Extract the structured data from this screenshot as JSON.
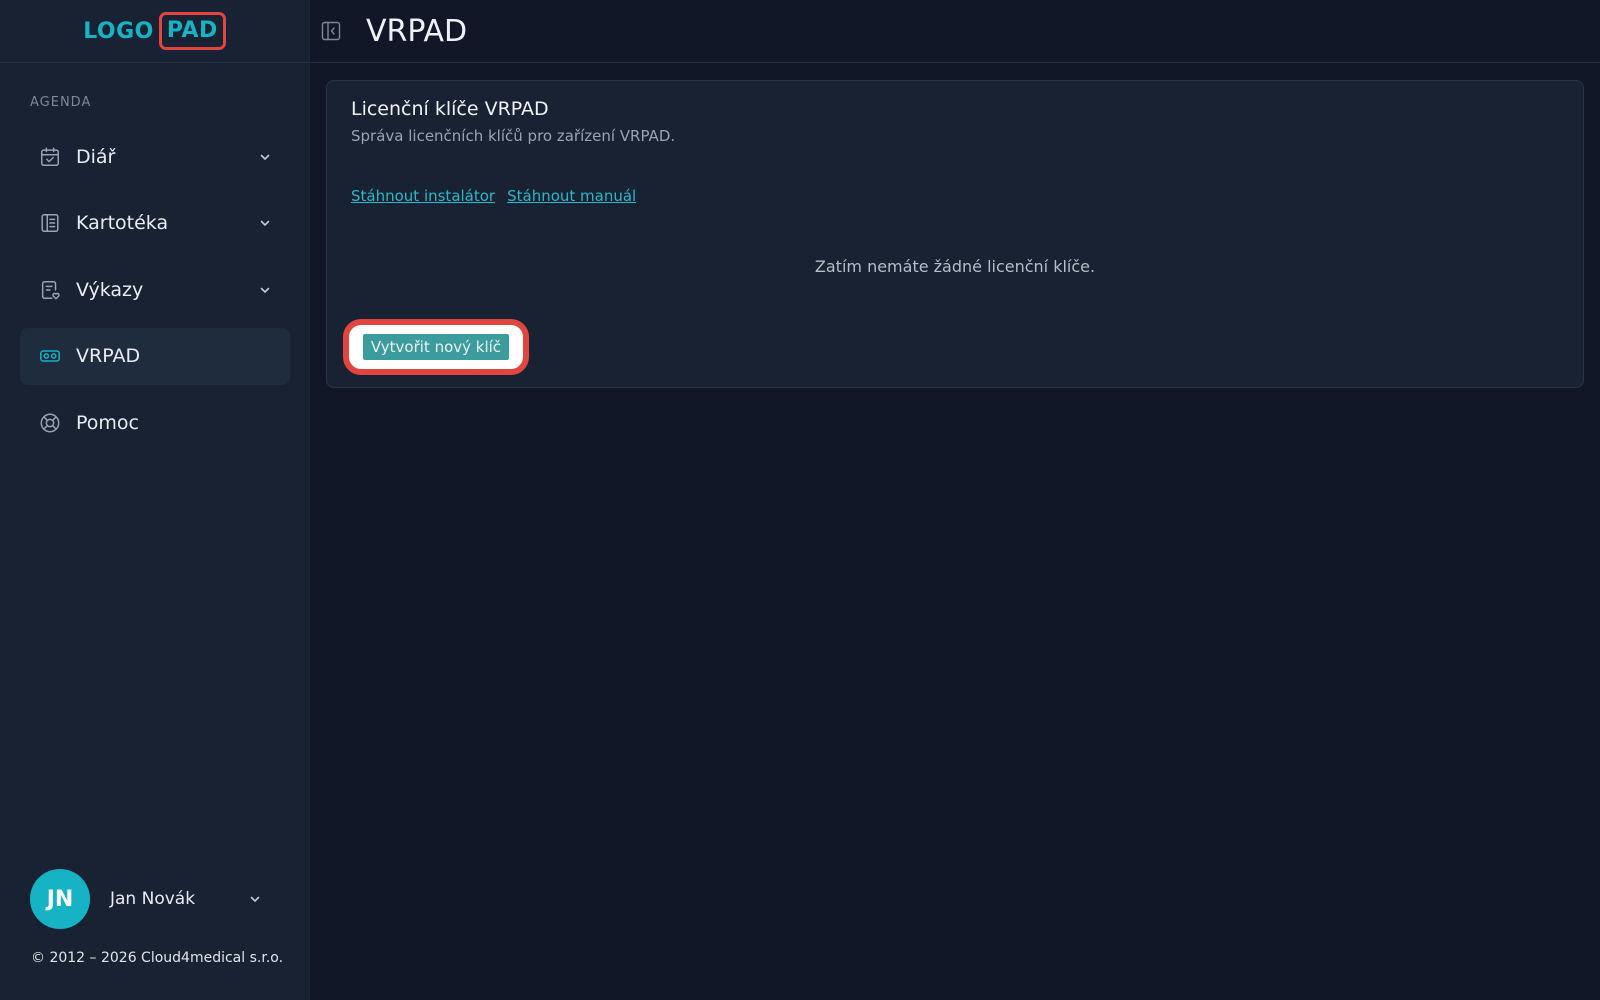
{
  "brand": {
    "logo_left": "LOGO",
    "logo_right": "PAD"
  },
  "sidebar": {
    "section_label": "AGENDA",
    "items": [
      {
        "label": "Diář",
        "icon": "calendar-check-icon",
        "has_chevron": true,
        "active": false
      },
      {
        "label": "Kartotéka",
        "icon": "card-file-icon",
        "has_chevron": true,
        "active": false
      },
      {
        "label": "Výkazy",
        "icon": "report-heart-icon",
        "has_chevron": true,
        "active": false
      },
      {
        "label": "VRPAD",
        "icon": "vr-headset-icon",
        "has_chevron": false,
        "active": true
      },
      {
        "label": "Pomoc",
        "icon": "lifebuoy-icon",
        "has_chevron": false,
        "active": false
      }
    ],
    "user": {
      "initials": "JN",
      "name": "Jan Novák"
    },
    "copyright": "© 2012 – 2026 Cloud4medical s.r.o."
  },
  "header": {
    "title": "VRPAD",
    "toggle_icon": "sidebar-toggle-icon"
  },
  "card": {
    "title": "Licenční klíče VRPAD",
    "subtitle": "Správa licenčních klíčů pro zařízení VRPAD.",
    "links": [
      {
        "label": "Stáhnout instalátor"
      },
      {
        "label": "Stáhnout manuál"
      }
    ],
    "empty_text": "Zatím nemáte žádné licenční klíče.",
    "create_button": "Vytvořit nový klíč"
  },
  "colors": {
    "accent": "#16b3c4",
    "highlight": "#e0463f",
    "background": "#111726",
    "sidebar_bg": "#192233",
    "button_bg": "#3c9b9d"
  }
}
